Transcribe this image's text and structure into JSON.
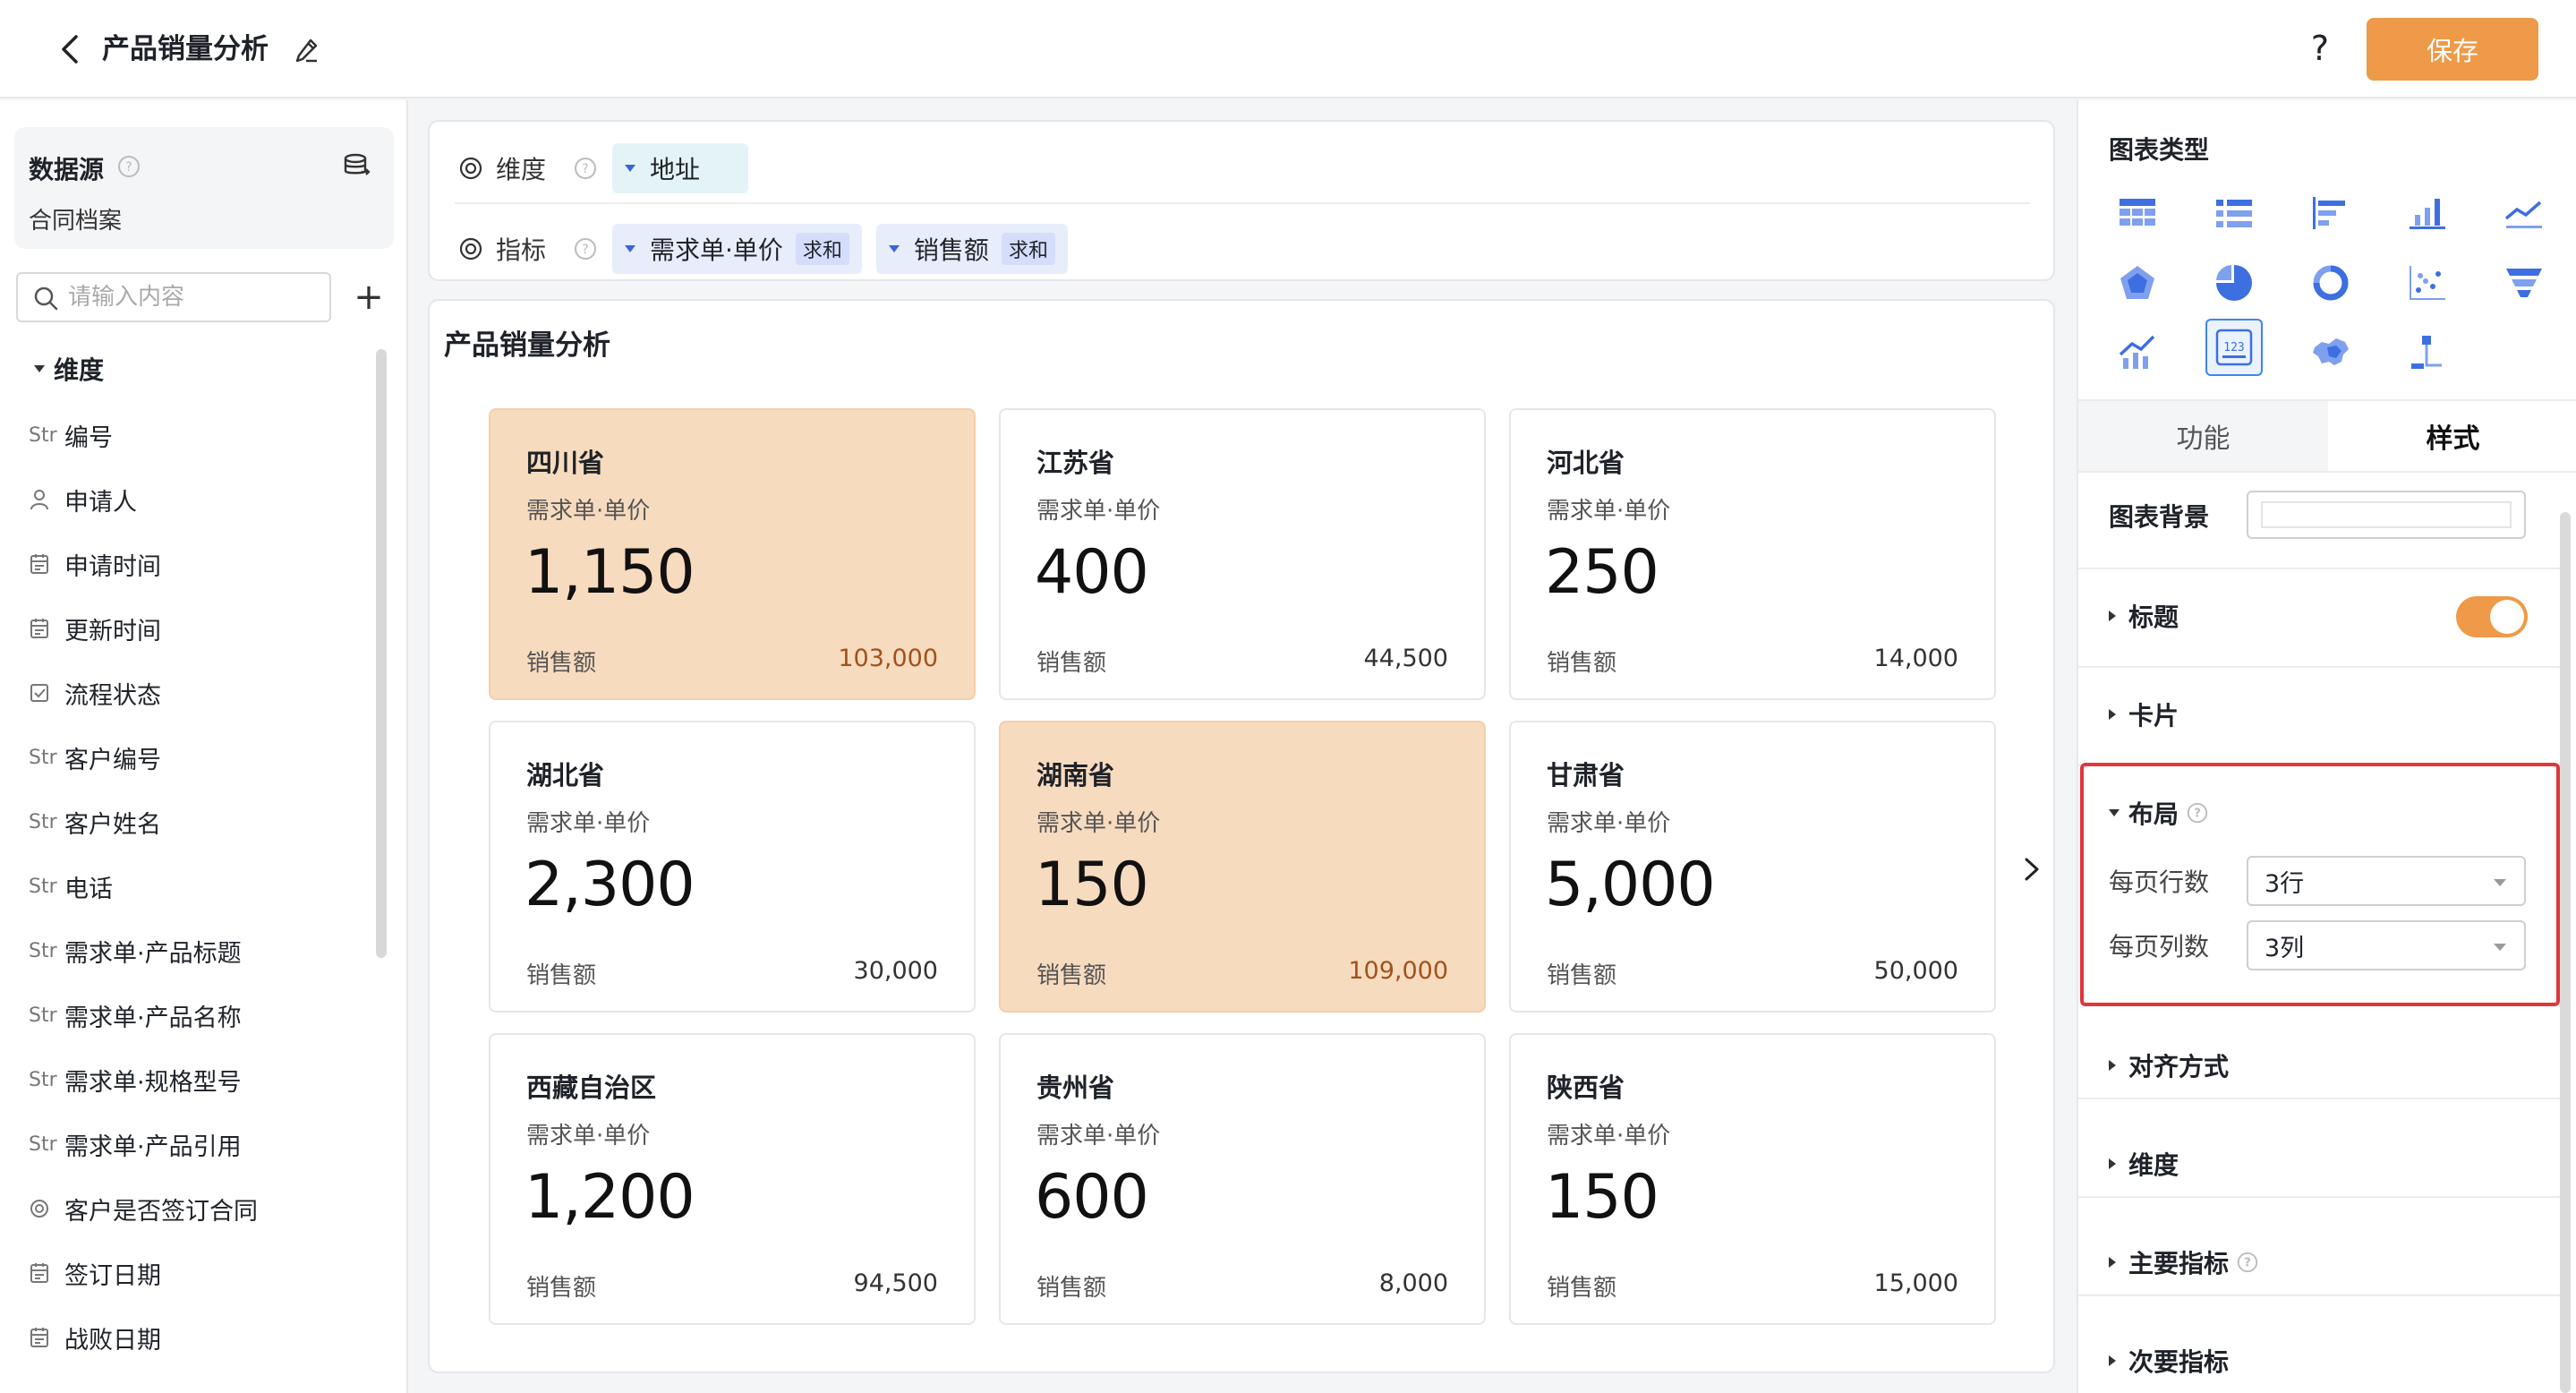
{
  "header": {
    "title": "产品销量分析",
    "help": "?",
    "save_label": "保存"
  },
  "left": {
    "datasource_title": "数据源",
    "datasource_name": "合同档案",
    "search_placeholder": "请输入内容",
    "add": "+",
    "dimension_heading": "维度",
    "fields": [
      {
        "type": "Str",
        "label": "编号"
      },
      {
        "type": "user",
        "label": "申请人"
      },
      {
        "type": "date",
        "label": "申请时间"
      },
      {
        "type": "date",
        "label": "更新时间"
      },
      {
        "type": "check",
        "label": "流程状态"
      },
      {
        "type": "Str",
        "label": "客户编号"
      },
      {
        "type": "Str",
        "label": "客户姓名"
      },
      {
        "type": "Str",
        "label": "电话"
      },
      {
        "type": "Str",
        "label": "需求单·产品标题"
      },
      {
        "type": "Str",
        "label": "需求单·产品名称"
      },
      {
        "type": "Str",
        "label": "需求单·规格型号"
      },
      {
        "type": "Str",
        "label": "需求单·产品引用"
      },
      {
        "type": "radio",
        "label": "客户是否签订合同"
      },
      {
        "type": "date",
        "label": "签订日期"
      },
      {
        "type": "date",
        "label": "战败日期"
      }
    ]
  },
  "config": {
    "dimension_label": "维度",
    "dimension_value": "地址",
    "metric_label": "指标",
    "metrics": [
      {
        "name": "需求单·单价",
        "agg": "求和"
      },
      {
        "name": "销售额",
        "agg": "求和"
      }
    ]
  },
  "chart": {
    "title": "产品销量分析",
    "primary_label": "需求单·单价",
    "secondary_label": "销售额",
    "cards": [
      {
        "name": "四川省",
        "primary": "1,150",
        "secondary": "103,000",
        "highlight": true
      },
      {
        "name": "江苏省",
        "primary": "400",
        "secondary": "44,500",
        "highlight": false
      },
      {
        "name": "河北省",
        "primary": "250",
        "secondary": "14,000",
        "highlight": false
      },
      {
        "name": "湖北省",
        "primary": "2,300",
        "secondary": "30,000",
        "highlight": false
      },
      {
        "name": "湖南省",
        "primary": "150",
        "secondary": "109,000",
        "highlight": true
      },
      {
        "name": "甘肃省",
        "primary": "5,000",
        "secondary": "50,000",
        "highlight": false
      },
      {
        "name": "西藏自治区",
        "primary": "1,200",
        "secondary": "94,500",
        "highlight": false
      },
      {
        "name": "贵州省",
        "primary": "600",
        "secondary": "8,000",
        "highlight": false
      },
      {
        "name": "陕西省",
        "primary": "150",
        "secondary": "15,000",
        "highlight": false
      }
    ]
  },
  "right": {
    "chart_type_title": "图表类型",
    "tabs": {
      "function": "功能",
      "style": "样式"
    },
    "chart_bg_label": "图表背景",
    "sections": {
      "title": "标题",
      "card": "卡片",
      "layout": "布局",
      "align": "对齐方式",
      "dimension": "维度",
      "main_metric": "主要指标",
      "secondary_metric": "次要指标"
    },
    "rows_label": "每页行数",
    "rows_value": "3行",
    "cols_label": "每页列数",
    "cols_value": "3列",
    "title_toggle": true
  },
  "colors": {
    "accent": "#ee9a48",
    "highlight_card": "#f7dbbf",
    "chart_icon": "#3d6fe0",
    "selection": "#e0373b"
  }
}
